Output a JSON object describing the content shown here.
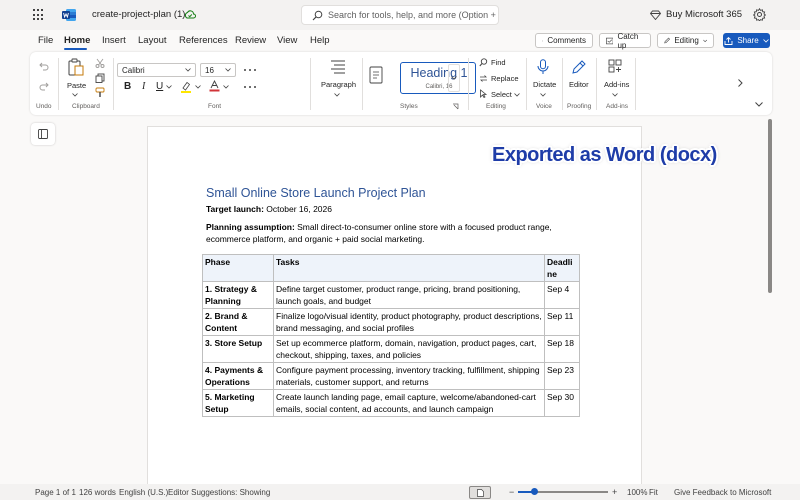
{
  "titlebar": {
    "doc_title": "create-project-plan (1)",
    "search_placeholder": "Search for tools, help, and more (Option + Q)",
    "buy_label": "Buy Microsoft 365"
  },
  "menu": {
    "items": [
      "File",
      "Home",
      "Insert",
      "Layout",
      "References",
      "Review",
      "View",
      "Help"
    ],
    "active": "Home",
    "comments_label": "Comments",
    "catchup_label": "Catch up",
    "editing_label": "Editing",
    "share_label": "Share"
  },
  "ribbon": {
    "undo_group": "Undo",
    "clipboard_group": "Clipboard",
    "paste_label": "Paste",
    "font_name": "Calibri",
    "font_size": "16",
    "font_group": "Font",
    "paragraph_label": "Paragraph",
    "style_heading": "Heading 1",
    "style_sub": "Calibri, 16",
    "styles_group": "Styles",
    "find_label": "Find",
    "replace_label": "Replace",
    "select_label": "Select",
    "editing_group": "Editing",
    "dictate_label": "Dictate",
    "voice_group": "Voice",
    "editor_label": "Editor",
    "proofing_group": "Proofing",
    "addins_label": "Add-ins",
    "addins_group": "Add-ins"
  },
  "document": {
    "banner": "Exported as Word (docx)",
    "title": "Small Online Store Launch Project Plan",
    "target_label": "Target launch:",
    "target_value": " October 16, 2026",
    "assumption_label": "Planning assumption:",
    "assumption_line1": " Small direct-to-consumer online store with a focused product range,",
    "assumption_line2": "ecommerce platform, and organic + paid social marketing.",
    "table": {
      "headers": [
        "Phase",
        "Tasks",
        "Deadline"
      ],
      "rows": [
        {
          "phase": "1. Strategy & Planning",
          "tasks": "Define target customer, product range, pricing, brand positioning, launch goals, and budget",
          "deadline": "Sep 4"
        },
        {
          "phase": "2. Brand & Content",
          "tasks": "Finalize logo/visual identity, product photography, product descriptions, brand messaging, and social profiles",
          "deadline": "Sep 11"
        },
        {
          "phase": "3. Store Setup",
          "tasks": "Set up ecommerce platform, domain, navigation, product pages, cart, checkout, shipping, taxes, and policies",
          "deadline": "Sep 18"
        },
        {
          "phase": "4. Payments & Operations",
          "tasks": "Configure payment processing, inventory tracking, fulfillment, shipping materials, customer support, and returns",
          "deadline": "Sep 23"
        },
        {
          "phase": "5. Marketing Setup",
          "tasks": "Create launch landing page, email capture, welcome/abandoned-cart emails, social content, ad accounts, and launch campaign",
          "deadline": "Sep 30"
        }
      ]
    }
  },
  "status": {
    "page": "Page 1 of 1",
    "words": "126 words",
    "language": "English (U.S.)",
    "editor": "Editor Suggestions: Showing",
    "zoom_minus": "−",
    "zoom_plus": "+",
    "zoom": "100%",
    "fit": "Fit",
    "feedback": "Give Feedback to Microsoft",
    "zoom_level": 100
  },
  "colors": {
    "accent": "#185abd",
    "heading": "#2f5496",
    "banner": "#1e3ca8"
  }
}
